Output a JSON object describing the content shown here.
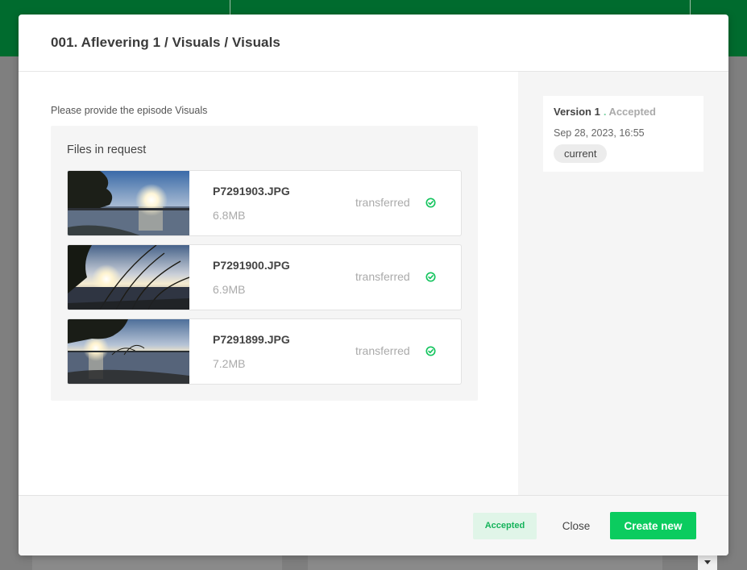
{
  "modal": {
    "title": "001. Aflevering 1 / Visuals / Visuals",
    "instruction": "Please provide the episode Visuals",
    "files_heading": "Files in request",
    "files": [
      {
        "name": "P7291903.JPG",
        "size": "6.8MB",
        "status": "transferred",
        "thumbnail": "lake-sunset-trees"
      },
      {
        "name": "P7291900.JPG",
        "size": "6.9MB",
        "status": "transferred",
        "thumbnail": "lake-sunset-reeds"
      },
      {
        "name": "P7291899.JPG",
        "size": "7.2MB",
        "status": "transferred",
        "thumbnail": "lake-sunset-shore"
      }
    ],
    "version": {
      "label": "Version 1",
      "separator": ".",
      "status": "Accepted",
      "date": "Sep 28, 2023, 16:55",
      "badge": "current"
    },
    "footer": {
      "status_label": "Accepted",
      "close_label": "Close",
      "create_label": "Create new"
    }
  },
  "colors": {
    "accent": "#0bcc5f",
    "header_green": "#006b2e",
    "accepted_bg": "#e0f5e8",
    "accepted_text": "#14b35a"
  }
}
